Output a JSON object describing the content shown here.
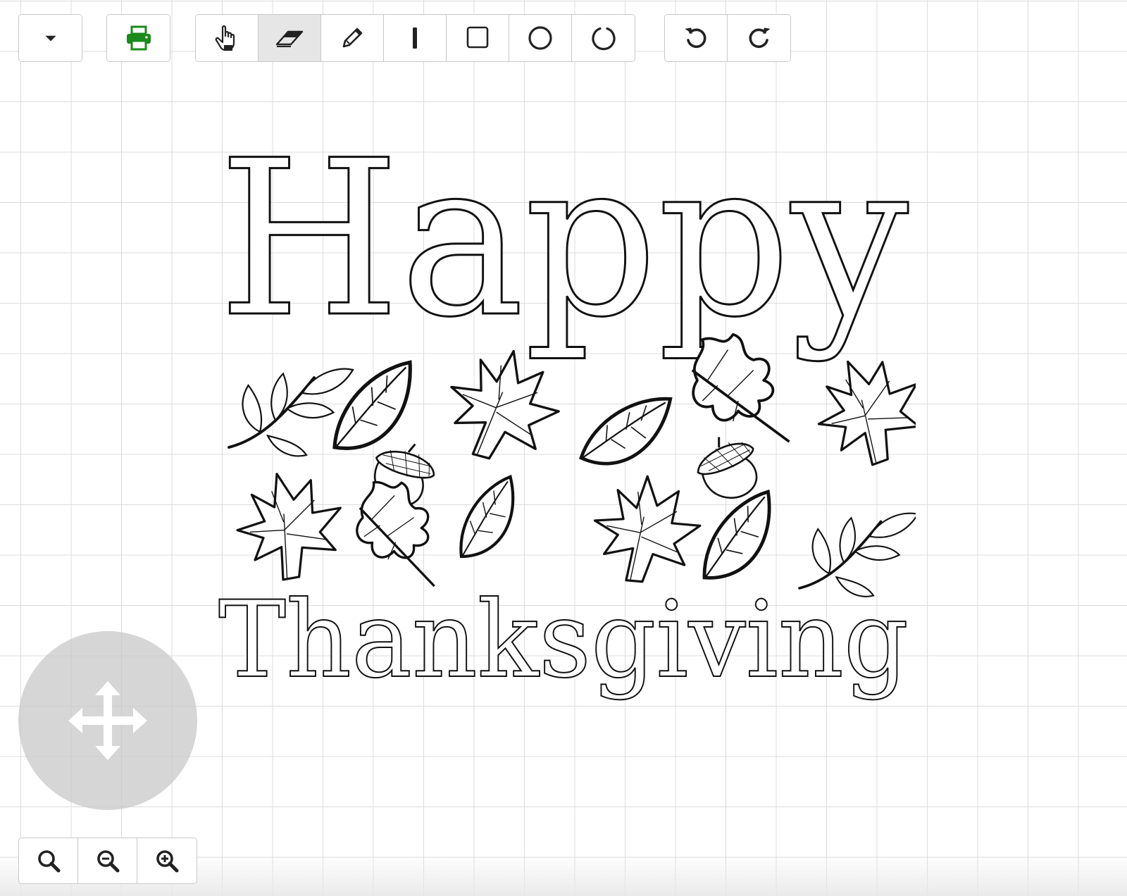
{
  "canvas": {
    "grid_color": "#dcdcdc",
    "background": "#ffffff"
  },
  "toolbar": {
    "menu_button": {
      "icon": "caret-down-icon"
    },
    "print_button": {
      "icon": "printer-icon",
      "color": "#1a8a1a"
    },
    "tools": [
      {
        "name": "pan-tool",
        "icon": "hand-pointer-icon",
        "active": false
      },
      {
        "name": "eraser-tool",
        "icon": "eraser-icon",
        "active": true
      },
      {
        "name": "pencil-tool",
        "icon": "pencil-icon",
        "active": false
      },
      {
        "name": "line-tool",
        "icon": "vertical-line-icon",
        "active": false
      },
      {
        "name": "rectangle-tool",
        "icon": "square-icon",
        "active": false
      },
      {
        "name": "circle-tool",
        "icon": "circle-icon",
        "active": false
      },
      {
        "name": "arc-tool",
        "icon": "arc-icon",
        "active": false
      }
    ],
    "history": [
      {
        "name": "undo",
        "icon": "undo-icon"
      },
      {
        "name": "redo",
        "icon": "redo-icon"
      }
    ]
  },
  "drawing": {
    "title_line_1": "Happy",
    "title_line_2": "Thanksgiving",
    "stroke_color": "#111111"
  },
  "pan_control": {
    "icon": "move-arrows-icon"
  },
  "zoom": [
    {
      "name": "zoom-fit",
      "icon": "magnifier-icon"
    },
    {
      "name": "zoom-out",
      "icon": "zoom-out-icon"
    },
    {
      "name": "zoom-in",
      "icon": "zoom-in-icon"
    }
  ]
}
